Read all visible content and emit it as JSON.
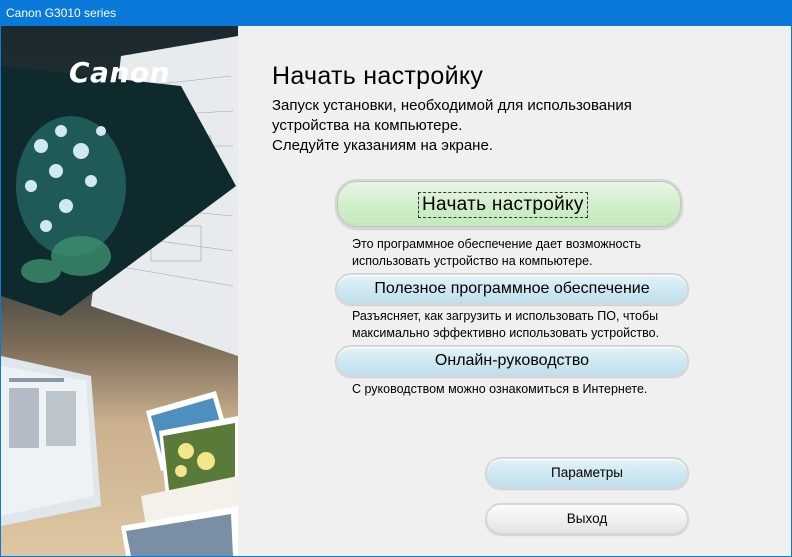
{
  "window": {
    "title": "Canon G3010 series"
  },
  "brand": {
    "logo_text": "Canon"
  },
  "main": {
    "heading": "Начать настройку",
    "intro_lines": [
      "Запуск установки, необходимой для использования",
      "устройства на компьютере.",
      "Следуйте указаниям на экране."
    ]
  },
  "actions": {
    "start_setup": {
      "label": "Начать настройку",
      "description_lines": [
        "Это программное обеспечение дает возможность",
        "использовать устройство на компьютере."
      ]
    },
    "useful_software": {
      "label": "Полезное программное обеспечение",
      "description_lines": [
        "Разъясняет, как загрузить и использовать ПО, чтобы",
        "максимально эффективно использовать устройство."
      ]
    },
    "online_manual": {
      "label": "Онлайн-руководство",
      "description_lines": [
        "С руководством можно ознакомиться в Интернете."
      ]
    },
    "settings": {
      "label": "Параметры"
    },
    "exit": {
      "label": "Выход"
    }
  },
  "colors": {
    "titlebar": "#0a79d9",
    "primary_button": "#cfeec9",
    "secondary_button": "#cfe8f1",
    "exit_button": "#efefef",
    "window_bg": "#f0f0f0"
  },
  "icons": [
    "canon-logo",
    "decorative-artwork"
  ]
}
